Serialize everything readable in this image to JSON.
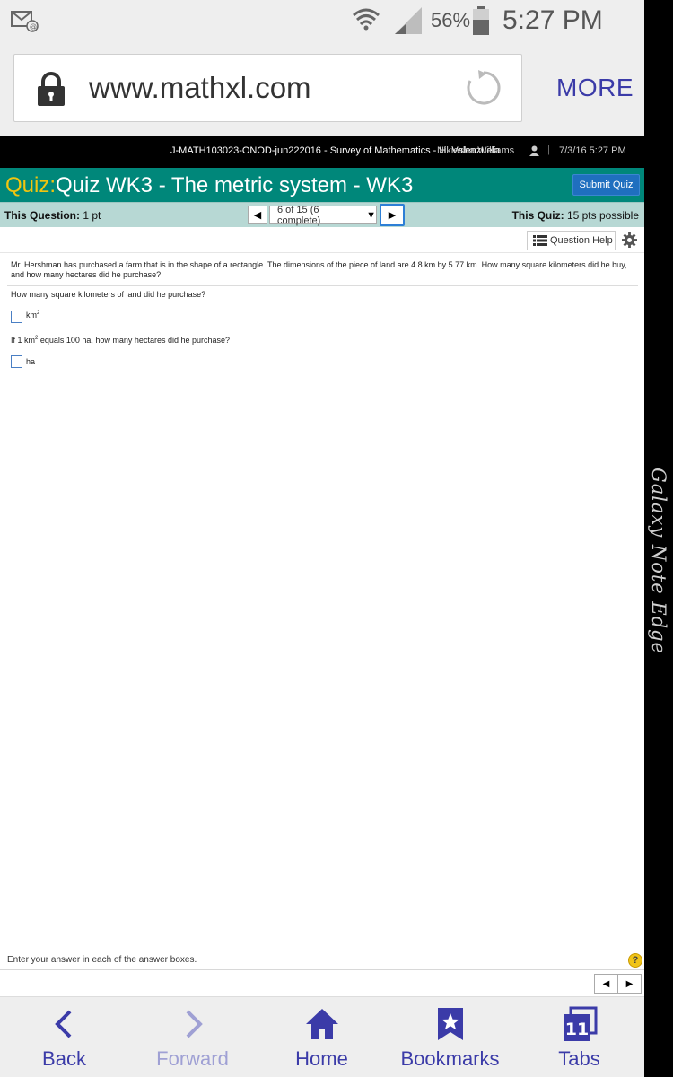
{
  "status_bar": {
    "battery_percent": "56%",
    "time": "5:27 PM"
  },
  "browser": {
    "url": "www.mathxl.com",
    "more_label": "MORE"
  },
  "course_bar": {
    "course_title": "J-MATH103023-ONOD-jun222016 - Survey of Mathematics - H. Valenzuela",
    "user_name": "Nikiesha Williams",
    "separator": "|",
    "datetime": "7/3/16 5:27 PM"
  },
  "quiz_header": {
    "label": "Quiz:",
    "title": "Quiz WK3 - The metric system - WK3",
    "submit_label": "Submit Quiz"
  },
  "info_bar": {
    "this_question_label": "This Question:",
    "this_question_value": "1 pt",
    "question_select": "6 of 15 (6 complete)",
    "this_quiz_label": "This Quiz:",
    "this_quiz_value": "15 pts possible"
  },
  "help": {
    "question_help_label": "Question Help"
  },
  "question": {
    "text": "Mr. Hershman has purchased a farm that is in the shape of a rectangle. The dimensions of the piece of land are 4.8 km by 5.77 km. How many square kilometers did he buy, and how many hectares did he purchase?",
    "part1_prompt": "How many square kilometers of land did he purchase?",
    "part1_unit": "km",
    "part1_unit_exp": "2",
    "part2_prompt_a": "If 1 km",
    "part2_prompt_exp": "2",
    "part2_prompt_b": " equals 100 ha, how many hectares did he purchase?",
    "part2_unit": "ha"
  },
  "footer": {
    "instruction": "Enter your answer in each of the answer boxes.",
    "help_symbol": "?"
  },
  "bottom_nav": {
    "back": "Back",
    "forward": "Forward",
    "home": "Home",
    "bookmarks": "Bookmarks",
    "tabs": "Tabs",
    "tabs_count": "11"
  },
  "device": {
    "edge_label": "Galaxy Note Edge"
  },
  "colors": {
    "quiz_header_bg": "#00877a",
    "quiz_label": "#f1c40f",
    "info_bar_bg": "#b7d8d4",
    "submit_bg": "#1f6fbf",
    "browser_accent": "#3b3ba8"
  }
}
